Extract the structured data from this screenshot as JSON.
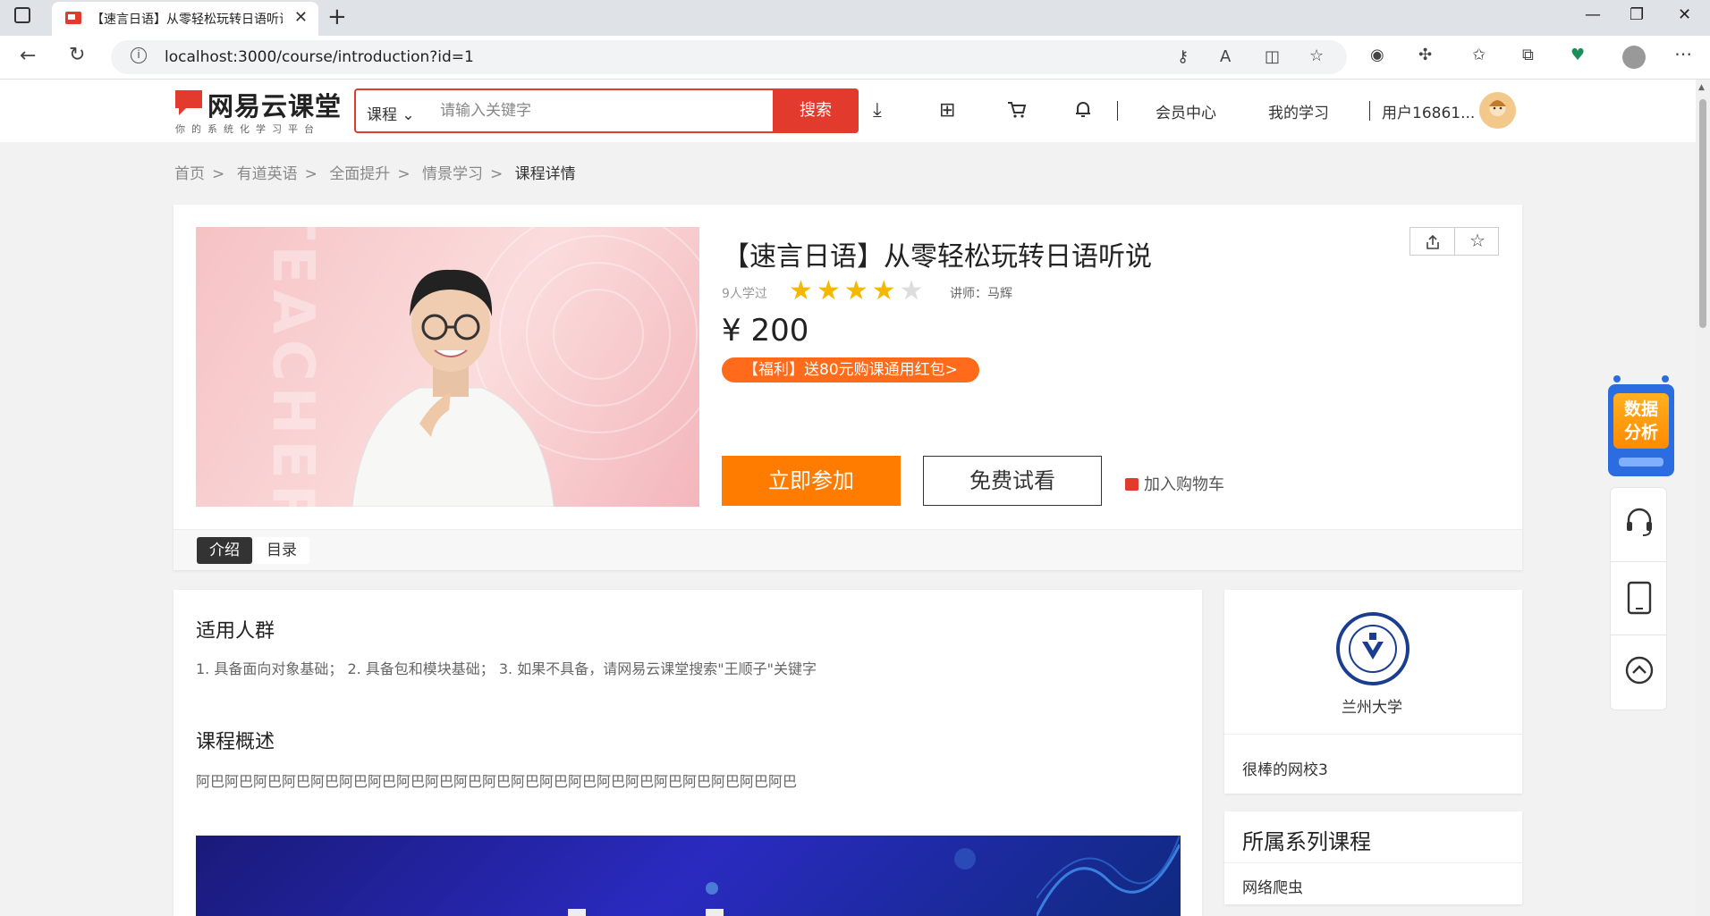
{
  "browser": {
    "tab_title": "【速言日语】从零轻松玩转日语听说",
    "url": "localhost:3000/course/introduction?id=1"
  },
  "header": {
    "logo": "网易云课堂",
    "slogan": "你的系统化学习平台",
    "search_category": "课程",
    "search_placeholder": "请输入关键字",
    "search_button": "搜索",
    "vip_center": "会员中心",
    "my_learning": "我的学习",
    "username": "用户16861..."
  },
  "breadcrumb": [
    "首页",
    "有道英语",
    "全面提升",
    "情景学习",
    "课程详情"
  ],
  "course": {
    "title": "【速言日语】从零轻松玩转日语听说",
    "learned": "9人学过",
    "rating": 4,
    "rating_max": 5,
    "teacher": "讲师：马辉",
    "price": "¥ 200",
    "promo": "【福利】送80元购课通用红包>",
    "join_button": "立即参加",
    "trial_button": "免费试看",
    "add_cart": "加入购物车",
    "cover_watermark": "TEACHER"
  },
  "tabs": [
    "介绍",
    "目录"
  ],
  "intro": {
    "audience_title": "适用人群",
    "audience_text": "1. 具备面向对象基础；  2. 具备包和模块基础；  3. 如果不具备，请网易云课堂搜索\"王顺子\"关键字",
    "overview_title": "课程概述",
    "overview_text": "阿巴阿巴阿巴阿巴阿巴阿巴阿巴阿巴阿巴阿巴阿巴阿巴阿巴阿巴阿巴阿巴阿巴阿巴阿巴阿巴阿巴"
  },
  "sidebar": {
    "school_name": "兰州大学",
    "school_desc": "很棒的网校3",
    "series_title": "所属系列课程",
    "series_item": "网络爬虫"
  },
  "float_widget": {
    "data_analysis": "数据分析"
  },
  "colors": {
    "brand_red": "#e33a2e",
    "join_orange": "#ff7c00",
    "promo_orange": "#ff6b1a",
    "star": "#f5b800"
  }
}
